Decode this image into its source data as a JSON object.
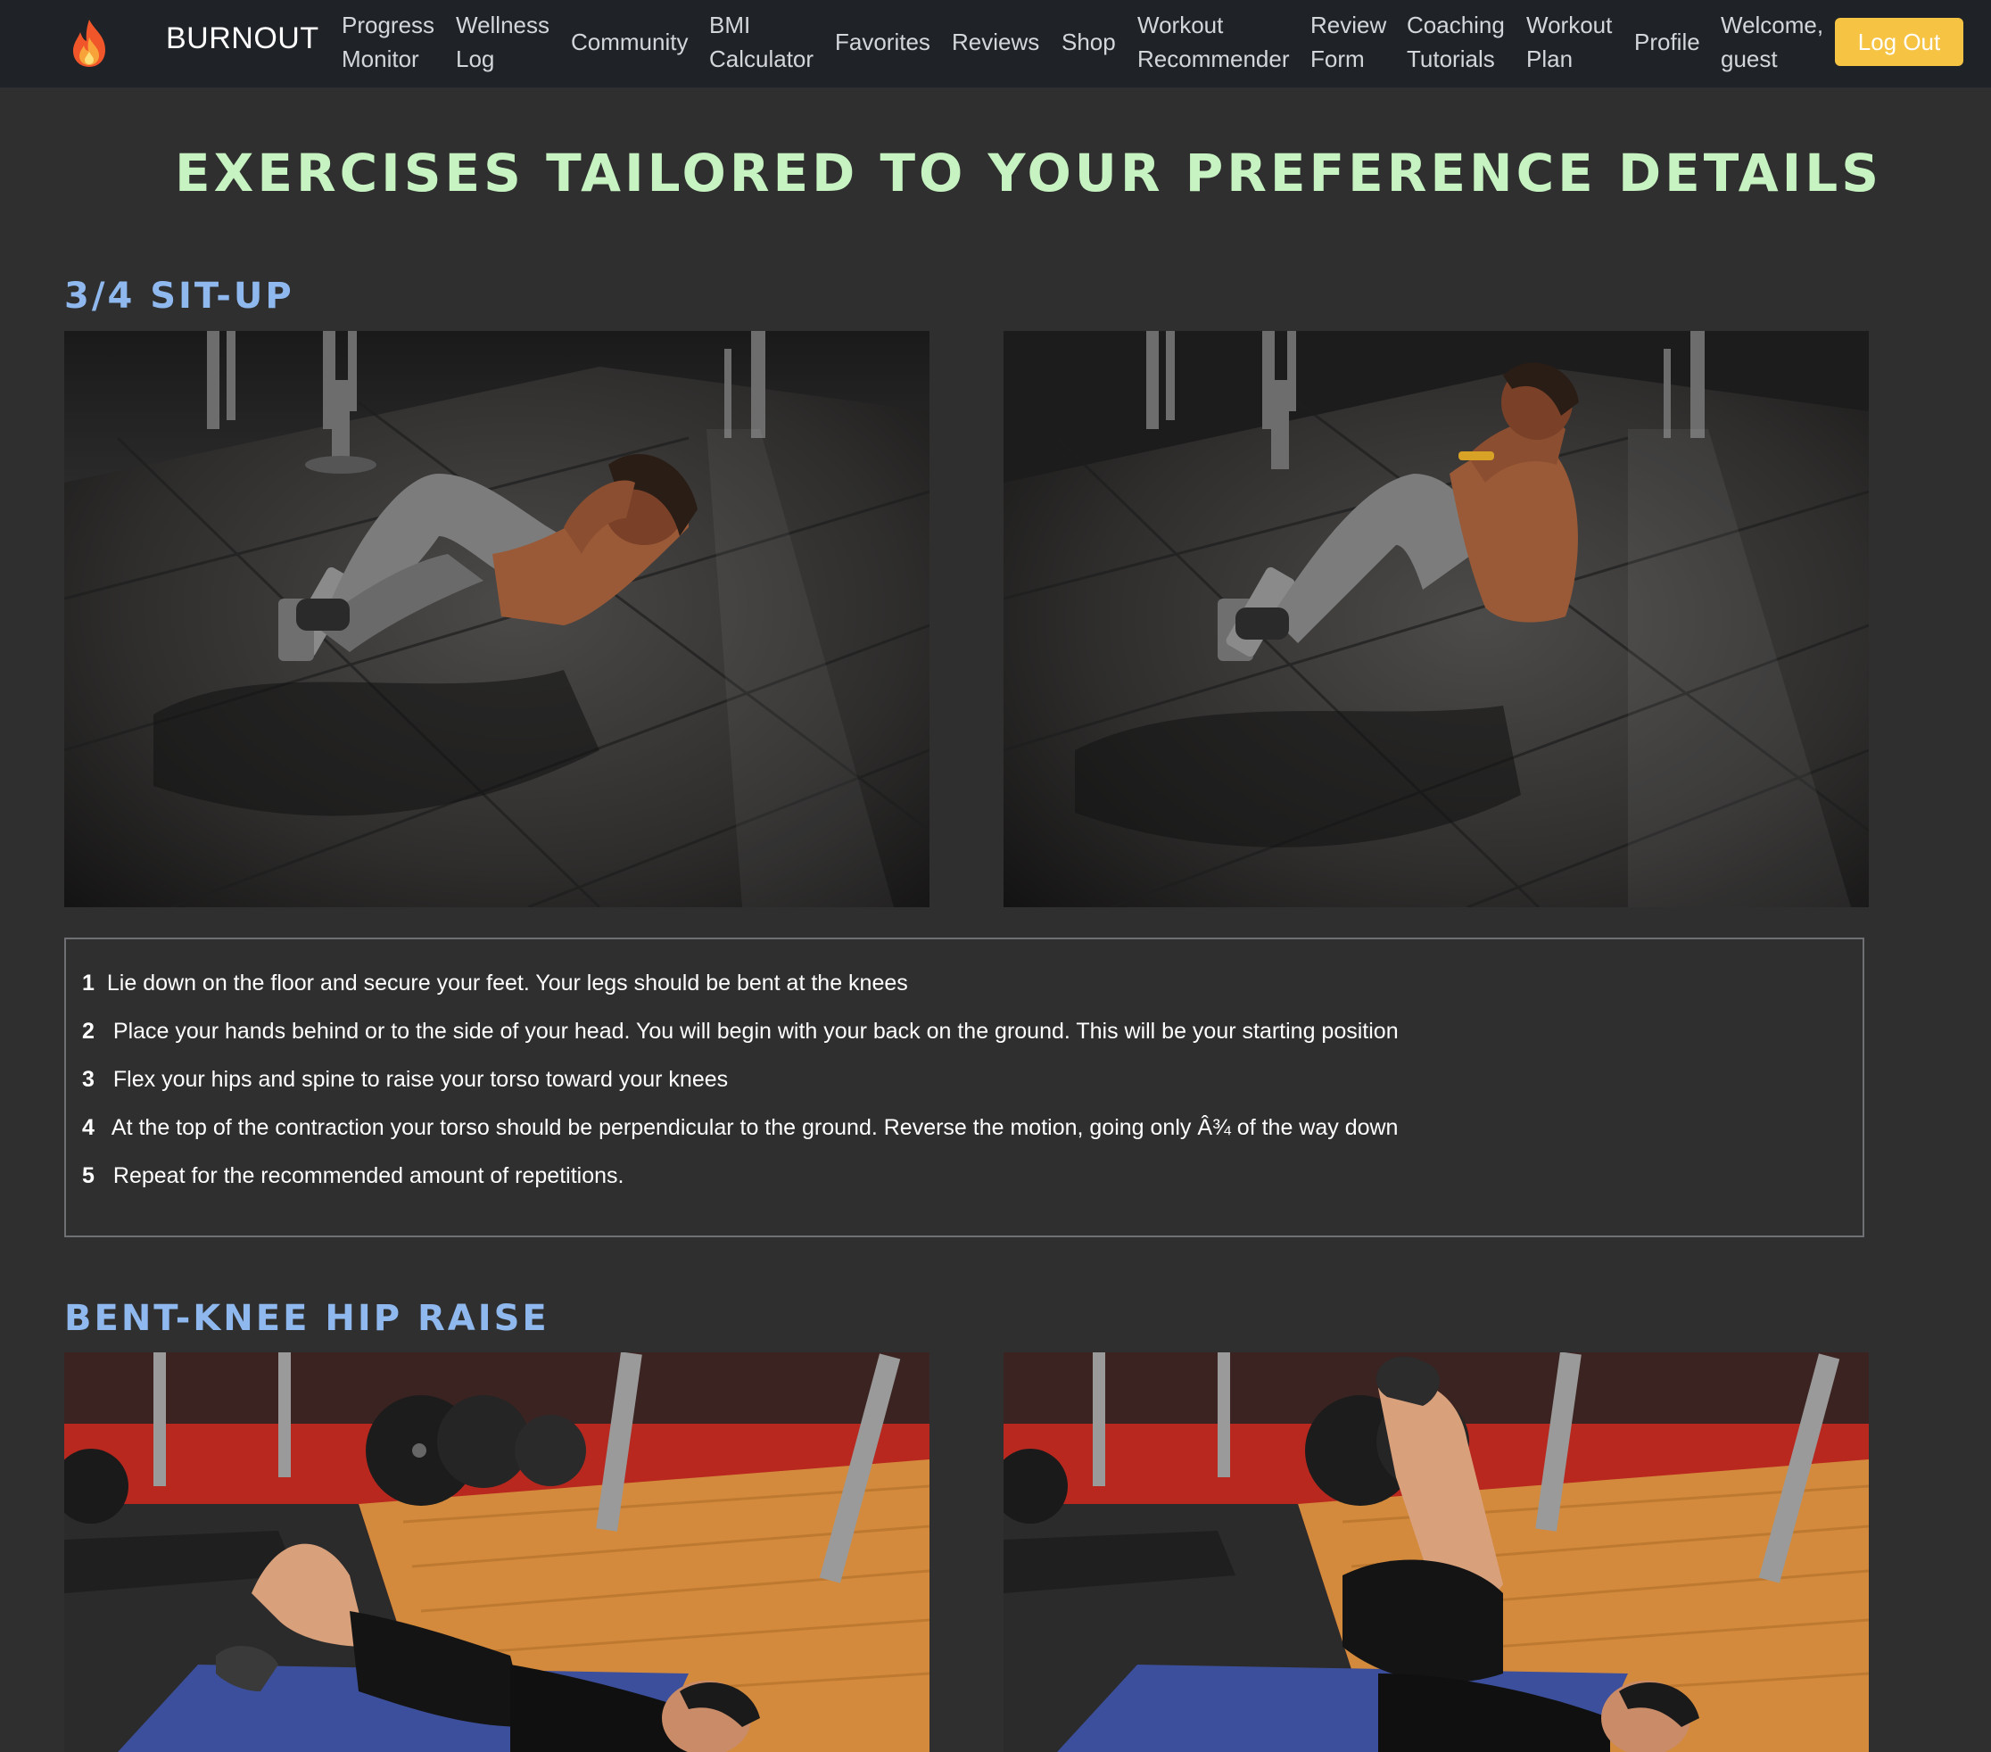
{
  "nav": {
    "brand": "BURNOUT",
    "logo_icon": "flame-icon",
    "links": [
      "Progress\nMonitor",
      "Wellness\nLog",
      "Community",
      "BMI\nCalculator",
      "Favorites",
      "Reviews",
      "Shop",
      "Workout\nRecommender",
      "Review\nForm",
      "Coaching\nTutorials",
      "Workout\nPlan",
      "Profile"
    ],
    "welcome": "Welcome,\nguest",
    "logout_label": "Log Out"
  },
  "page_title": "EXERCISES TAILORED TO YOUR PREFERENCE DETAILS",
  "exercises": [
    {
      "name": "3/4 SIT-UP",
      "steps": [
        {
          "num": "1",
          "text": "Lie down on the floor and secure your feet. Your legs should be bent at the knees"
        },
        {
          "num": "2",
          "text": "Place your hands behind or to the side of your head. You will begin with your back on the ground. This will be your starting position"
        },
        {
          "num": "3",
          "text": "Flex your hips and spine to raise your torso toward your knees"
        },
        {
          "num": "4",
          "text": "At the top of the contraction your torso should be perpendicular to the ground. Reverse the motion, going only Â¾ of the way down"
        },
        {
          "num": "5",
          "text": "Repeat for the recommended amount of repetitions."
        }
      ]
    },
    {
      "name": "BENT-KNEE HIP RAISE"
    }
  ],
  "colors": {
    "background": "#2f2f2f",
    "navbar": "#1f2227",
    "title_green": "#c7f3c2",
    "exercise_blue": "#8fb8ef",
    "logout_yellow": "#f6c343"
  }
}
